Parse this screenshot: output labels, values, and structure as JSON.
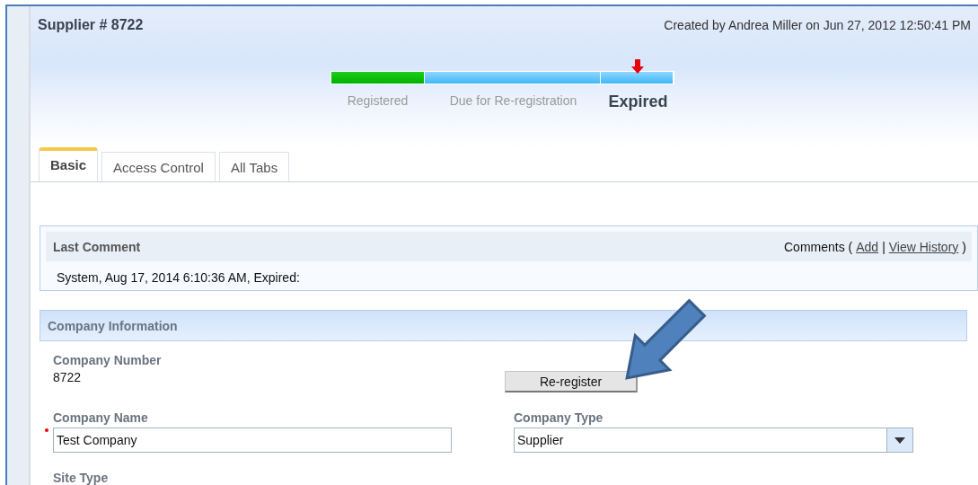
{
  "header": {
    "title": "Supplier # 8722",
    "created": "Created by Andrea Miller on Jun 27, 2012 12:50:41 PM"
  },
  "stages": [
    {
      "label": "Registered",
      "completed": true,
      "selected": false
    },
    {
      "label": "Due for Re-registration",
      "completed": false,
      "selected": false
    },
    {
      "label": "Expired",
      "completed": false,
      "selected": true
    }
  ],
  "tabs": [
    {
      "label": "Basic",
      "selected": true
    },
    {
      "label": "Access Control",
      "selected": false
    },
    {
      "label": "All Tabs",
      "selected": false
    }
  ],
  "last_comment": {
    "title": "Last Comment",
    "comments_label": "Comments (",
    "add": "Add",
    "separator": "|",
    "view_history": "View History",
    "close": ")",
    "text": "System, Aug 17, 2014 6:10:36 AM, Expired:"
  },
  "company_information": {
    "title": "Company Information",
    "company_number": {
      "label": "Company Number",
      "value": "8722"
    },
    "reregister_button": "Re-register",
    "company_name": {
      "label": "Company Name",
      "value": "Test Company",
      "required": true
    },
    "company_type": {
      "label": "Company Type",
      "value": "Supplier"
    },
    "site_type": {
      "label": "Site Type"
    }
  }
}
